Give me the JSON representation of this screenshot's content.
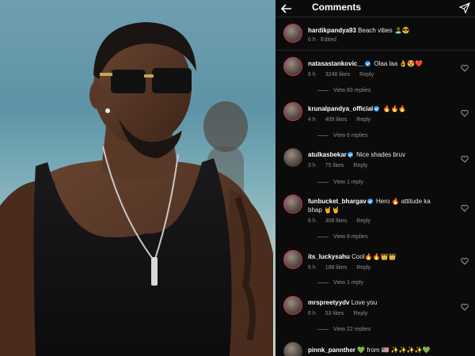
{
  "header": {
    "title": "Comments",
    "back_icon": "arrow-left-icon",
    "send_icon": "paper-plane-icon"
  },
  "caption": {
    "username": "hardikpandya93",
    "text": "Beach vibes 🏝️😎",
    "time": "6 h",
    "edited": "Edited"
  },
  "comments": [
    {
      "username": "natasastankovic__",
      "verified": true,
      "text": "Olaa laa 👌😍❤️",
      "time": "6 h",
      "likes": "3248 likes",
      "reply": "Reply",
      "view_replies": "View 83 replies"
    },
    {
      "username": "krunalpandya_official",
      "verified": true,
      "text": "🔥🔥🔥",
      "time": "4 h",
      "likes": "409 likes",
      "reply": "Reply",
      "view_replies": "View 6 replies"
    },
    {
      "username": "atulkasbekar",
      "verified": true,
      "text": "Nice shades bruv",
      "time": "3 h",
      "likes": "75 likes",
      "reply": "Reply",
      "view_replies": "View 1 reply"
    },
    {
      "username": "funbucket_bhargav",
      "verified": true,
      "text": "Hero 🔥 attitude ka bhap 🤘🤘",
      "time": "6 h",
      "likes": "308 likes",
      "reply": "Reply",
      "view_replies": "View 8 replies"
    },
    {
      "username": "its_luckysahu",
      "verified": false,
      "text": "Cool🔥🔥👑👑",
      "time": "6 h",
      "likes": "188 likes",
      "reply": "Reply",
      "view_replies": "View 1 reply"
    },
    {
      "username": "mrspreetyydv",
      "verified": false,
      "text": "Love you",
      "time": "6 h",
      "likes": "53 likes",
      "reply": "Reply",
      "view_replies": "View 22 replies"
    },
    {
      "username": "pinnk_pannther",
      "verified": false,
      "text": "💚 from 🇺🇸 ✨✨✨✨💚"
    }
  ],
  "colors": {
    "background": "#0b0b0b",
    "verified": "#3897f0",
    "story_ring": "#d6295f",
    "muted": "#8e8e8e"
  }
}
